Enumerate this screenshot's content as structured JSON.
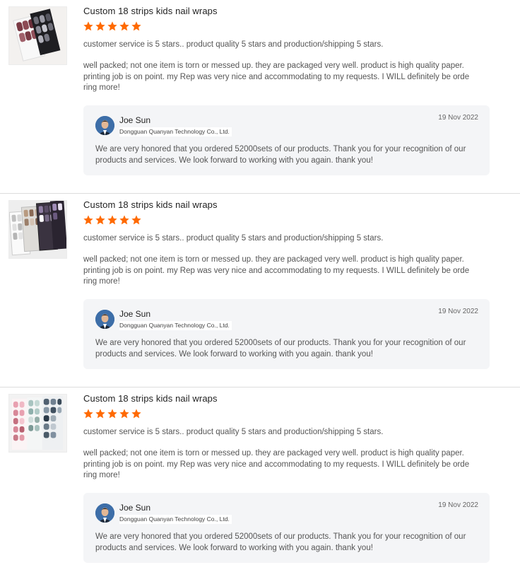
{
  "reviews": [
    {
      "title": "Custom 18 strips kids nail wraps",
      "rating": 5,
      "max_rating": 5,
      "summary": "customer service is 5 stars.. product quality 5 stars and production/shipping 5 stars.",
      "body": "well packed; not one item is torn or messed up. they are packaged very well. product is high quality paper. printing job is on point. my Rep was very nice and accommodating to my requests. I WILL definitely be ordering more!",
      "reply": {
        "name": "Joe Sun",
        "company": "Dongguan Quanyan Technology Co., Ltd.",
        "date": "19 Nov 2022",
        "text": "We are very honored that you ordered 52000sets of our products. Thank you for your recognition of our products and services. We look forward to working with you again. thank you!"
      }
    },
    {
      "title": "Custom 18 strips kids nail wraps",
      "rating": 5,
      "max_rating": 5,
      "summary": "customer service is 5 stars.. product quality 5 stars and production/shipping 5 stars.",
      "body": "well packed; not one item is torn or messed up. they are packaged very well. product is high quality paper. printing job is on point. my Rep was very nice and accommodating to my requests. I WILL definitely be ordering more!",
      "reply": {
        "name": "Joe Sun",
        "company": "Dongguan Quanyan Technology Co., Ltd.",
        "date": "19 Nov 2022",
        "text": "We are very honored that you ordered 52000sets of our products. Thank you for your recognition of our products and services. We look forward to working with you again. thank you!"
      }
    },
    {
      "title": "Custom 18 strips kids nail wraps",
      "rating": 5,
      "max_rating": 5,
      "summary": "customer service is 5 stars.. product quality 5 stars and production/shipping 5 stars.",
      "body": "well packed; not one item is torn or messed up. they are packaged very well. product is high quality paper. printing job is on point. my Rep was very nice and accommodating to my requests. I WILL definitely be ordering more!",
      "reply": {
        "name": "Joe Sun",
        "company": "Dongguan Quanyan Technology Co., Ltd.",
        "date": "19 Nov 2022",
        "text": "We are very honored that you ordered 52000sets of our products. Thank you for your recognition of our products and services. We look forward to working with you again. thank you!"
      }
    }
  ],
  "colors": {
    "star": "#ff6a00",
    "reply_bg": "#f4f5f7",
    "divider": "#dcdcdc"
  },
  "icons": {
    "star": "star-icon",
    "avatar": "avatar-photo"
  }
}
